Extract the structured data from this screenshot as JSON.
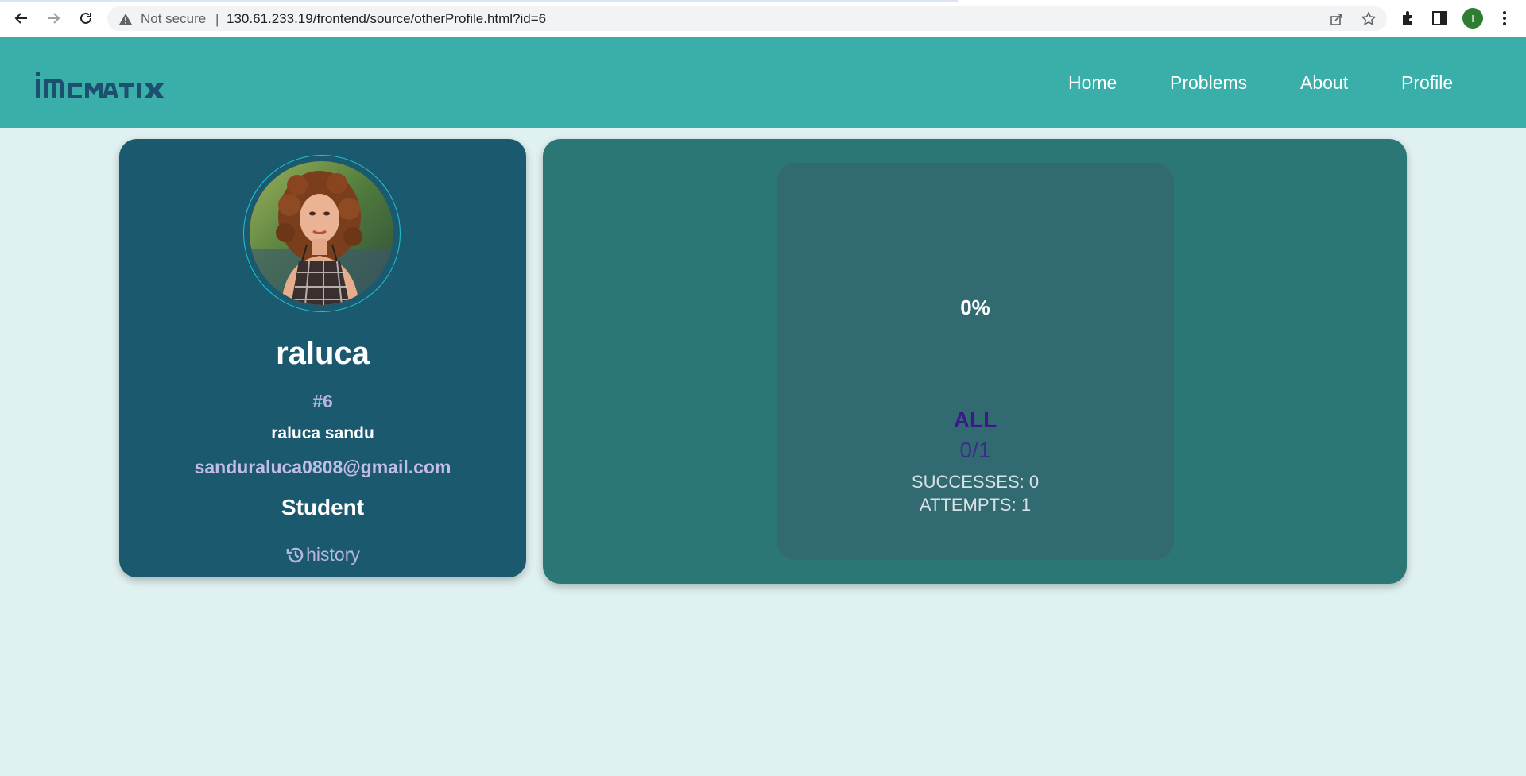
{
  "browser": {
    "security_label": "Not secure",
    "separator": "|",
    "url": "130.61.233.19/frontend/source/otherProfile.html?id=6",
    "profile_initial": "I"
  },
  "header": {
    "logo_text": "imormatix",
    "nav": [
      {
        "label": "Home"
      },
      {
        "label": "Problems"
      },
      {
        "label": "About"
      },
      {
        "label": "Profile"
      }
    ]
  },
  "profile": {
    "username": "raluca",
    "rank": "#6",
    "full_name": "raluca sandu",
    "email": "sanduraluca0808@gmail.com",
    "role": "Student",
    "history_label": "history"
  },
  "stats": {
    "percent": "0%",
    "progress": 0,
    "category": "ALL",
    "ratio": "0/1",
    "successes_text": "SUCCESSES: 0",
    "attempts_text": "ATTEMPTS: 1"
  },
  "colors": {
    "header": "#3aaea8",
    "background": "#dff1f0",
    "profile_card": "#1b5a6e",
    "stats_panel": "#2b7775",
    "stat_box": "#326a72",
    "category_text": "#3a1a86"
  }
}
